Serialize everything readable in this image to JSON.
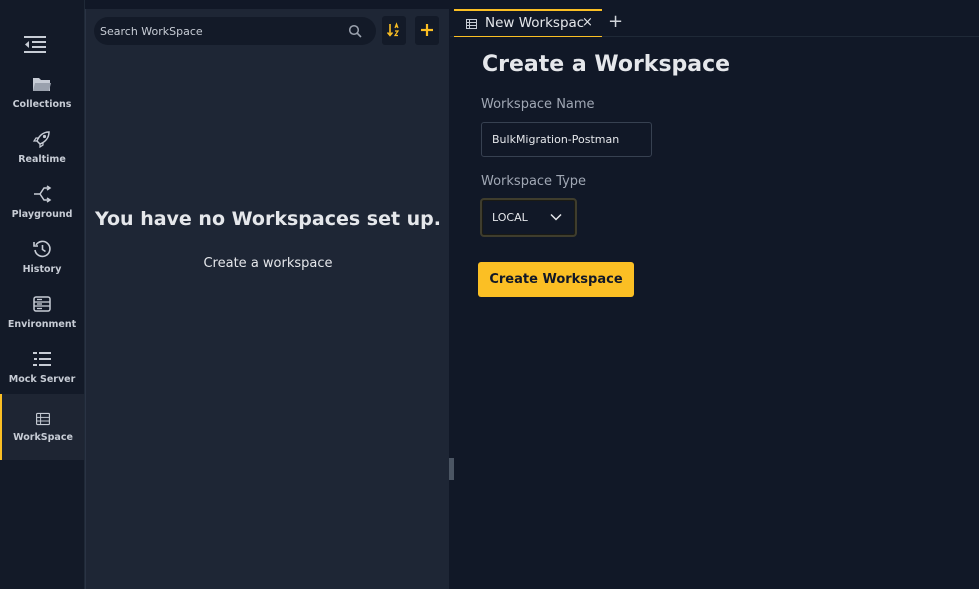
{
  "sidebar": {
    "items": [
      {
        "label": "Collections",
        "icon": "folder-icon"
      },
      {
        "label": "Realtime",
        "icon": "rocket-icon"
      },
      {
        "label": "Playground",
        "icon": "branch-icon"
      },
      {
        "label": "History",
        "icon": "history-icon"
      },
      {
        "label": "Environment",
        "icon": "server-icon"
      },
      {
        "label": "Mock Server",
        "icon": "list-icon"
      },
      {
        "label": "WorkSpace",
        "icon": "workspace-icon",
        "active": true
      }
    ]
  },
  "panel": {
    "search_placeholder": "Search WorkSpace",
    "empty_title": "You have no Workspaces set up.",
    "empty_link": "Create a workspace"
  },
  "tabs": [
    {
      "label": "New Workspac",
      "close": "×",
      "active": true
    }
  ],
  "new_tab_label": "+",
  "form": {
    "title": "Create a Workspace",
    "name_label": "Workspace Name",
    "name_value": "BulkMigration-Postman",
    "type_label": "Workspace Type",
    "type_value": "LOCAL",
    "submit_label": "Create Workspace"
  },
  "colors": {
    "accent": "#fbbf24",
    "background": "#111827",
    "panel": "#1e2635",
    "rail": "#131a28"
  }
}
